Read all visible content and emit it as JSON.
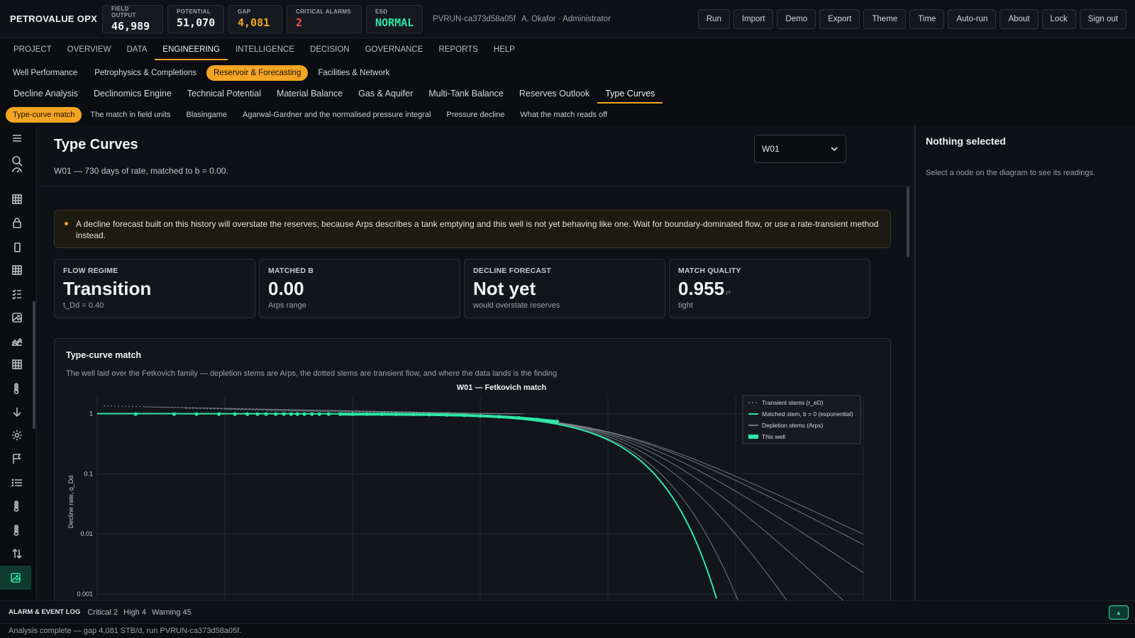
{
  "brand": "PETROVALUE OPX",
  "kpis": [
    {
      "label": "FIELD OUTPUT",
      "value": "46,989",
      "color": "#f1f3f5"
    },
    {
      "label": "POTENTIAL",
      "value": "51,070",
      "color": "#f1f3f5"
    },
    {
      "label": "GAP",
      "value": "4,081",
      "color": "#f5a524"
    },
    {
      "label": "CRITICAL ALARMS",
      "value": "2",
      "color": "#ff4d4f"
    },
    {
      "label": "ESD",
      "value": "NORMAL",
      "color": "#2ee6a6"
    }
  ],
  "run_id": "PVRUN-ca373d58a05f",
  "user": "A. Okafor · Administrator",
  "actions": [
    "Run",
    "Import",
    "Demo",
    "Export",
    "Theme",
    "Time",
    "Auto-run",
    "About",
    "Lock",
    "Sign out"
  ],
  "main_nav": {
    "items": [
      "PROJECT",
      "OVERVIEW",
      "DATA",
      "ENGINEERING",
      "INTELLIGENCE",
      "DECISION",
      "GOVERNANCE",
      "REPORTS",
      "HELP"
    ],
    "active": "ENGINEERING"
  },
  "sub_nav": {
    "items": [
      "Well Performance",
      "Petrophysics & Completions",
      "Reservoir & Forecasting",
      "Facilities & Network"
    ],
    "active": "Reservoir & Forecasting"
  },
  "tab_nav": {
    "items": [
      "Decline Analysis",
      "Declinomics Engine",
      "Technical Potential",
      "Material Balance",
      "Gas & Aquifer",
      "Multi-Tank Balance",
      "Reserves Outlook",
      "Type Curves"
    ],
    "active": "Type Curves"
  },
  "pill_nav": {
    "items": [
      "Type-curve match",
      "The match in field units",
      "Blasingame",
      "Agarwal-Gardner and the normalised pressure integral",
      "Pressure decline",
      "What the match reads off"
    ],
    "active": "Type-curve match"
  },
  "rail_icons": [
    "menu-icon",
    "search-icon",
    "gauge-icon",
    "grid-icon",
    "lock-icon",
    "phone-icon",
    "table-icon",
    "checklist-icon",
    "image-icon",
    "area-chart-icon",
    "grid-icon",
    "thermometer-icon",
    "arrow-down-icon",
    "settings-icon",
    "flag-icon",
    "list-icon",
    "thermometer-icon",
    "thermometer-icon",
    "sort-icon",
    "image-icon"
  ],
  "page": {
    "title": "Type Curves",
    "subtitle": "W01 — 730 days of rate, matched to b = 0.00.",
    "well_select": "W01"
  },
  "alert": "A decline forecast built on this history will overstate the reserves, because Arps describes a tank emptying and this well is not yet behaving like one. Wait for boundary-dominated flow, or use a rate-transient method instead.",
  "cards": [
    {
      "label": "FLOW REGIME",
      "value": "Transition",
      "unit": "",
      "sub": "t_Dd = 0.40"
    },
    {
      "label": "MATCHED B",
      "value": "0.00",
      "unit": "",
      "sub": "Arps range"
    },
    {
      "label": "DECLINE FORECAST",
      "value": "Not yet",
      "unit": "",
      "sub": "would overstate reserves"
    },
    {
      "label": "MATCH QUALITY",
      "value": "0.955",
      "unit": "r²",
      "sub": "tight"
    }
  ],
  "chart_card": {
    "title": "Type-curve match",
    "description": "The well laid over the Fetkovich family — depletion stems are Arps, the dotted stems are transient flow, and where the data lands is the finding"
  },
  "chart_data": {
    "type": "line",
    "title": "W01 — Fetkovich match",
    "xlabel": "",
    "ylabel": "Decline rate, q_Dd",
    "y_scale": "log",
    "x_scale": "log",
    "ylim": [
      0.001,
      2
    ],
    "y_ticks": [
      "1",
      "0.1",
      "0.01",
      "0.001"
    ],
    "xlim": [
      0.0001,
      100
    ],
    "grid": true,
    "legend_position": "top-right",
    "legend": [
      "Transient stems (r_eD)",
      "Matched stem, b = 0 (exponential)",
      "Depletion stems (Arps)",
      "This well"
    ],
    "colors": {
      "matched": "#2ee6a6",
      "well": "#2ee6a6",
      "stems": "#8a9099",
      "transient": "#8a9099"
    },
    "depletion_b": [
      0,
      0.1,
      0.3,
      0.5,
      0.7,
      0.9,
      1.0
    ],
    "matched_b": 0,
    "transient_stems": 5,
    "well_points_tDd": [
      0.0002,
      0.0004,
      0.0006,
      0.0009,
      0.0012,
      0.0015,
      0.0018,
      0.0021,
      0.0025,
      0.0029,
      0.0033,
      0.0037,
      0.0042,
      0.0048,
      0.0055,
      0.0065,
      0.008,
      0.01,
      0.013,
      0.017,
      0.022,
      0.03,
      0.04,
      0.055,
      0.075,
      0.1,
      0.14,
      0.2,
      0.28,
      0.4
    ],
    "well_points_qDd": [
      0.985,
      0.985,
      0.985,
      0.985,
      0.985,
      0.985,
      0.985,
      0.985,
      0.985,
      0.985,
      0.985,
      0.985,
      0.985,
      0.985,
      0.985,
      0.985,
      0.984,
      0.983,
      0.982,
      0.98,
      0.978,
      0.972,
      0.965,
      0.955,
      0.94,
      0.92,
      0.89,
      0.85,
      0.8,
      0.74
    ]
  },
  "right_panel": {
    "title": "Nothing selected",
    "subtitle": "Select a node on the diagram to see its readings."
  },
  "event_log": {
    "title": "ALARM & EVENT LOG",
    "critical": "Critical 2",
    "high": "High 4",
    "warning": "Warning 45"
  },
  "status": "Analysis complete — gap 4,081 STB/d, run PVRUN-ca373d58a05f."
}
